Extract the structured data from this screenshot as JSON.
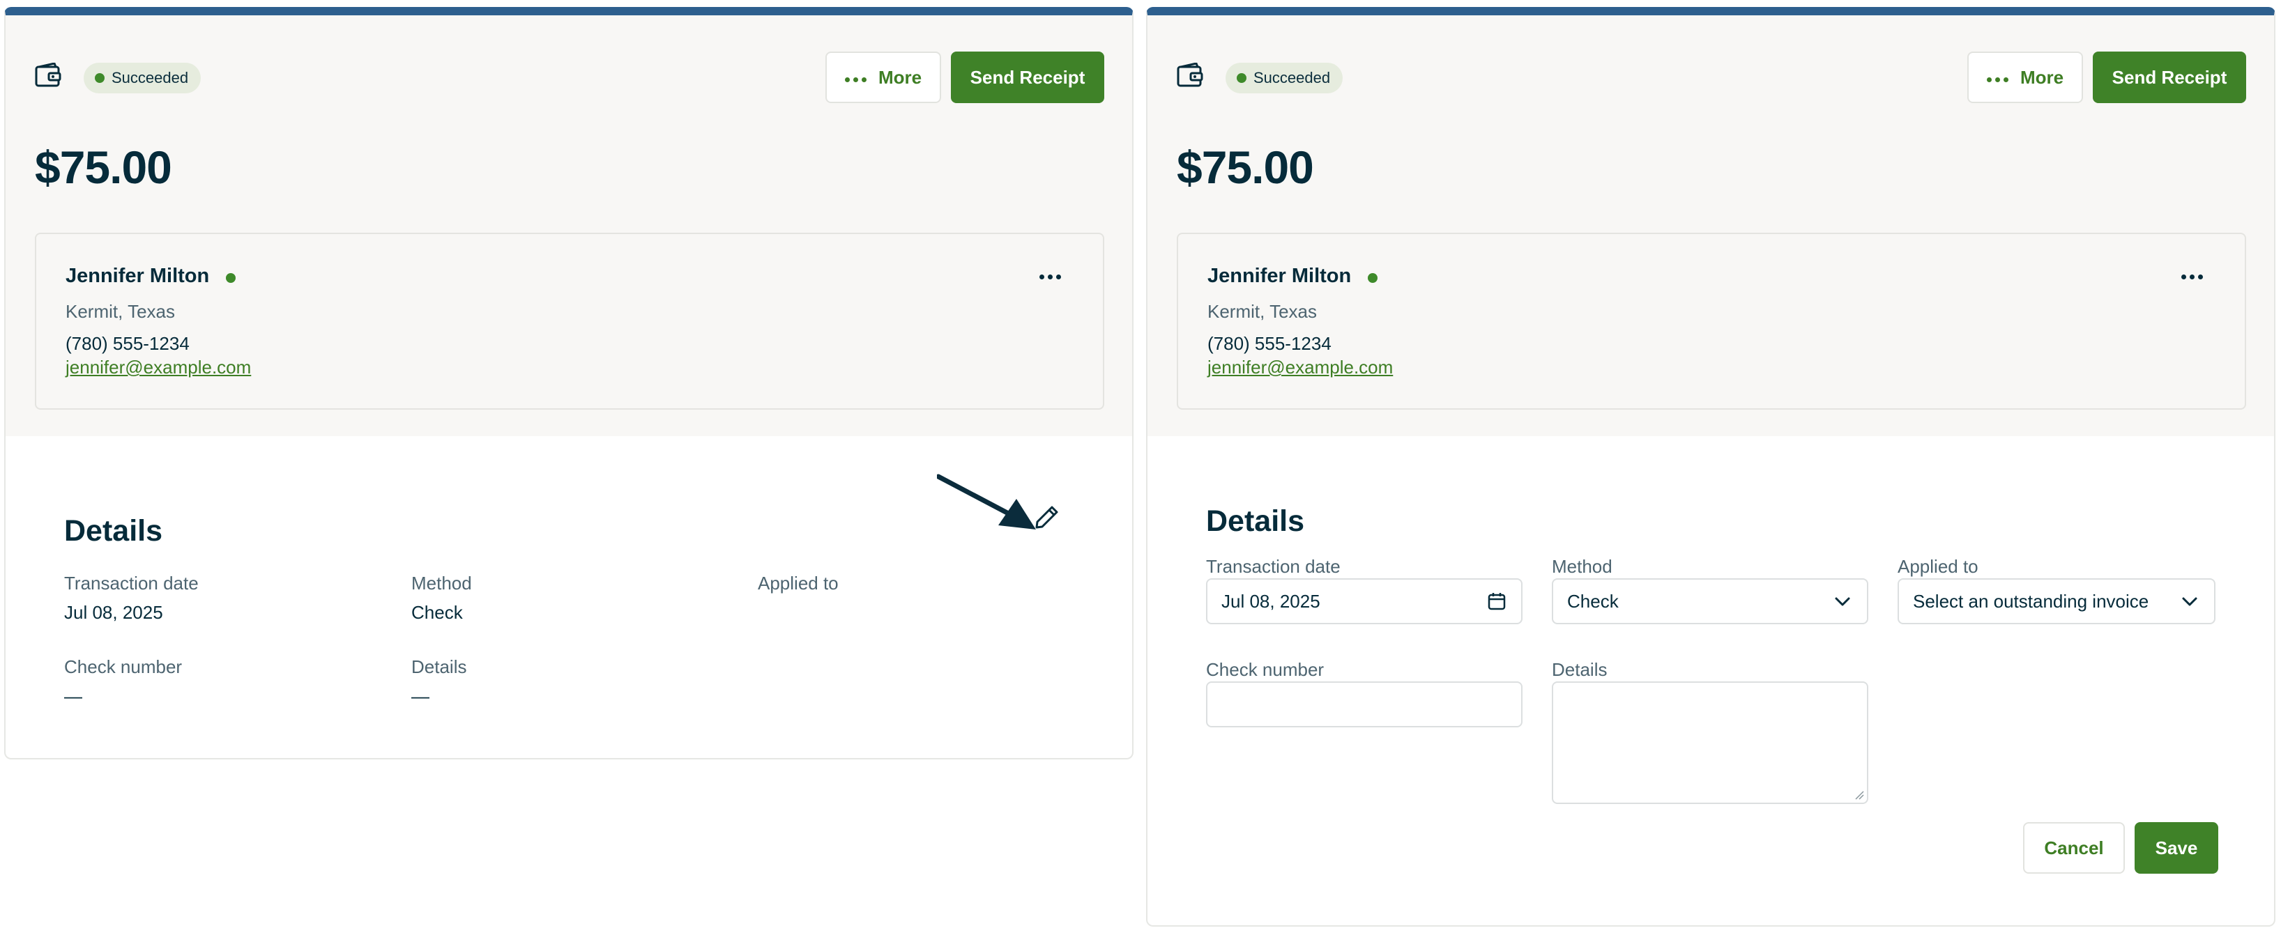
{
  "colors": {
    "accent_bar": "#2d5f8e",
    "brand_green": "#3f8228",
    "status_dot": "#3e8a2a",
    "text_dark": "#062b3a",
    "text_muted": "#4d6470",
    "header_bg": "#f8f7f5"
  },
  "view_panel": {
    "status_badge": "Succeeded",
    "more_label": "More",
    "send_receipt_label": "Send Receipt",
    "amount": "$75.00",
    "contact": {
      "name": "Jennifer Milton",
      "location": "Kermit, Texas",
      "phone": "(780) 555-1234",
      "email": "jennifer@example.com"
    },
    "details": {
      "title": "Details",
      "transaction_date_label": "Transaction date",
      "transaction_date_value": "Jul 08, 2025",
      "method_label": "Method",
      "method_value": "Check",
      "applied_to_label": "Applied to",
      "check_number_label": "Check number",
      "check_number_value": "—",
      "details_label": "Details",
      "details_value": "—"
    },
    "icons": {
      "wallet": "wallet-icon",
      "edit": "pencil-icon",
      "annotation": "arrow-icon",
      "contact_menu": "ellipsis-icon"
    }
  },
  "edit_panel": {
    "status_badge": "Succeeded",
    "more_label": "More",
    "send_receipt_label": "Send Receipt",
    "amount": "$75.00",
    "contact": {
      "name": "Jennifer Milton",
      "location": "Kermit, Texas",
      "phone": "(780) 555-1234",
      "email": "jennifer@example.com"
    },
    "form": {
      "title": "Details",
      "transaction_date_label": "Transaction date",
      "transaction_date_value": "Jul 08, 2025",
      "method_label": "Method",
      "method_value": "Check",
      "applied_to_label": "Applied to",
      "applied_to_value": "Select an outstanding invoice",
      "check_number_label": "Check number",
      "check_number_value": "",
      "details_label": "Details",
      "details_value": "",
      "cancel_label": "Cancel",
      "save_label": "Save"
    },
    "icons": {
      "wallet": "wallet-icon",
      "date_picker": "calendar-icon",
      "dropdown": "chevron-down-icon",
      "contact_menu": "ellipsis-icon"
    }
  }
}
